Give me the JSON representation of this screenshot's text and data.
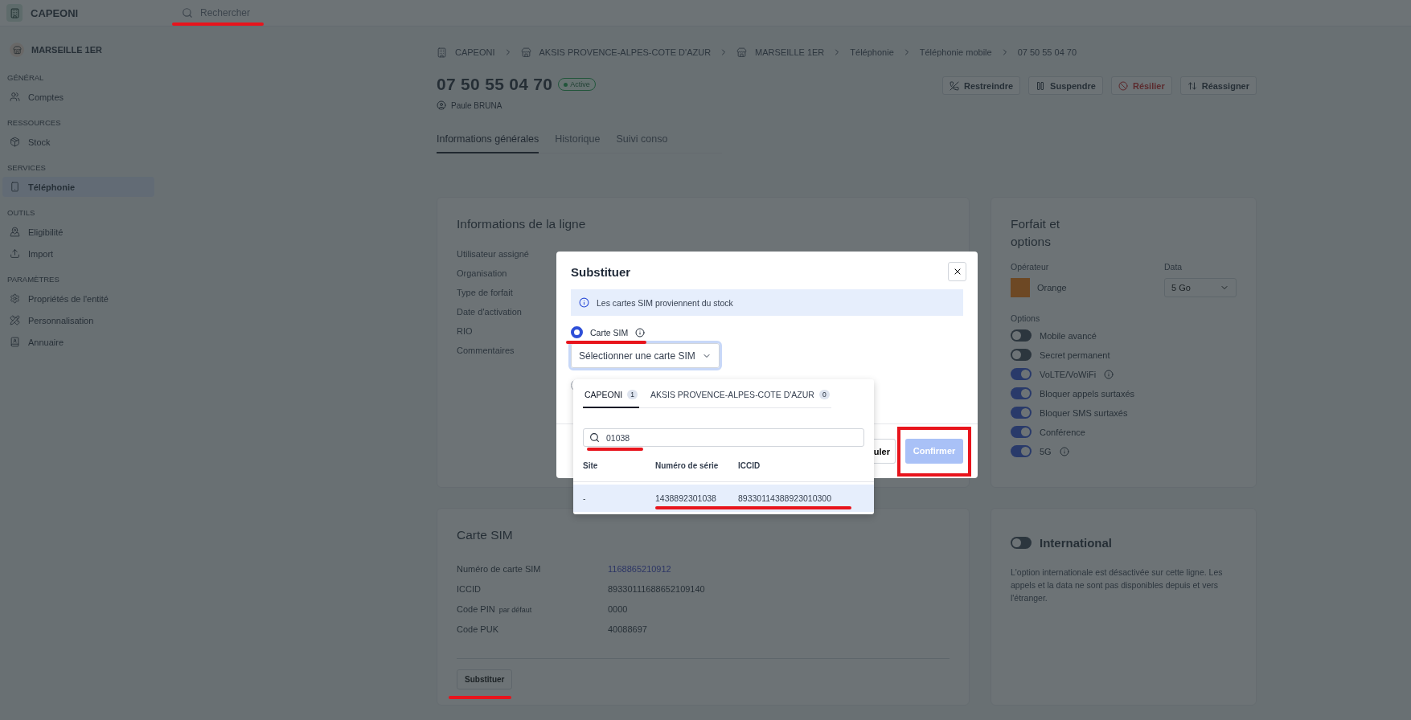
{
  "app": {
    "name": "CAPEONI",
    "search_placeholder": "Rechercher"
  },
  "sidebar": {
    "entity": "MARSEILLE 1ER",
    "sections": [
      {
        "title": "GÉNÉRAL",
        "items": [
          {
            "label": "Comptes",
            "selected": false
          }
        ]
      },
      {
        "title": "RESSOURCES",
        "items": [
          {
            "label": "Stock",
            "selected": false
          }
        ]
      },
      {
        "title": "SERVICES",
        "items": [
          {
            "label": "Téléphonie",
            "selected": true
          }
        ]
      },
      {
        "title": "OUTILS",
        "items": [
          {
            "label": "Eligibilité",
            "selected": false
          },
          {
            "label": "Import",
            "selected": false
          }
        ]
      },
      {
        "title": "PARAMÈTRES",
        "items": [
          {
            "label": "Propriétés de l'entité",
            "selected": false
          },
          {
            "label": "Personnalisation",
            "selected": false
          },
          {
            "label": "Annuaire",
            "selected": false
          }
        ]
      }
    ]
  },
  "breadcrumb": [
    "CAPEONI",
    "AKSIS PROVENCE-ALPES-COTE D'AZUR",
    "MARSEILLE 1ER",
    "Téléphonie",
    "Téléphonie mobile",
    "07 50 55 04 70"
  ],
  "line": {
    "number": "07 50 55 04 70",
    "status": "Active",
    "user": "Paule BRUNA"
  },
  "actions": [
    {
      "label": "Restreindre",
      "kind": "normal"
    },
    {
      "label": "Suspendre",
      "kind": "normal"
    },
    {
      "label": "Résilier",
      "kind": "danger"
    },
    {
      "label": "Réassigner",
      "kind": "normal"
    }
  ],
  "tabs": [
    {
      "label": "Informations générales",
      "selected": true
    },
    {
      "label": "Historique",
      "selected": false
    },
    {
      "label": "Suivi conso",
      "selected": false
    }
  ],
  "line_info": {
    "title": "Informations de la ligne",
    "fields": [
      "Utilisateur assigné",
      "Organisation",
      "Type de forfait",
      "Date d'activation",
      "RIO",
      "Commentaires"
    ]
  },
  "plan": {
    "title": "Forfait et options",
    "operator_label": "Opérateur",
    "operator": "Orange",
    "data_label": "Data",
    "data_value": "5 Go",
    "options_label": "Options",
    "options": [
      {
        "label": "Mobile avancé",
        "on": false,
        "info": false
      },
      {
        "label": "Secret permanent",
        "on": false,
        "info": false
      },
      {
        "label": "VoLTE/VoWiFi",
        "on": true,
        "info": true
      },
      {
        "label": "Bloquer appels surtaxés",
        "on": true,
        "info": false
      },
      {
        "label": "Bloquer SMS surtaxés",
        "on": true,
        "info": false
      },
      {
        "label": "Conférence",
        "on": true,
        "info": false
      },
      {
        "label": "5G",
        "on": true,
        "info": true
      }
    ]
  },
  "international": {
    "title": "International",
    "on": false,
    "description": "L'option internationale est désactivée sur cette ligne. Les appels et la data ne sont pas disponibles depuis et vers l'étranger."
  },
  "sim_card": {
    "title": "Carte SIM",
    "fields": [
      {
        "label": "Numéro de carte SIM",
        "value": "1168865210912",
        "kind": "link"
      },
      {
        "label": "ICCID",
        "value": "89330111688652109140",
        "kind": "text"
      },
      {
        "label": "Code PIN",
        "note": "par défaut",
        "value": "0000",
        "kind": "text"
      },
      {
        "label": "Code PUK",
        "value": "40088697",
        "kind": "text"
      }
    ],
    "button": "Substituer"
  },
  "modal": {
    "title": "Substituer",
    "info": "Les cartes SIM proviennent du stock",
    "choices": [
      {
        "label": "Carte SIM",
        "selected": true
      },
      {
        "selected": false
      }
    ],
    "select_placeholder": "Sélectionner une carte SIM",
    "popover": {
      "tabs": [
        {
          "label": "CAPEONI",
          "count": "1",
          "selected": true
        },
        {
          "label": "AKSIS PROVENCE-ALPES-COTE D'AZUR",
          "count": "0",
          "selected": false
        }
      ],
      "search_value": "01038",
      "columns": [
        "Site",
        "Numéro de série",
        "ICCID"
      ],
      "rows": [
        {
          "cells": [
            "-",
            "1438892301038",
            "89330114388923010300"
          ],
          "selected": true
        }
      ]
    },
    "cancel": "uler",
    "confirm": "Confirmer",
    "confirm_disabled": true
  }
}
